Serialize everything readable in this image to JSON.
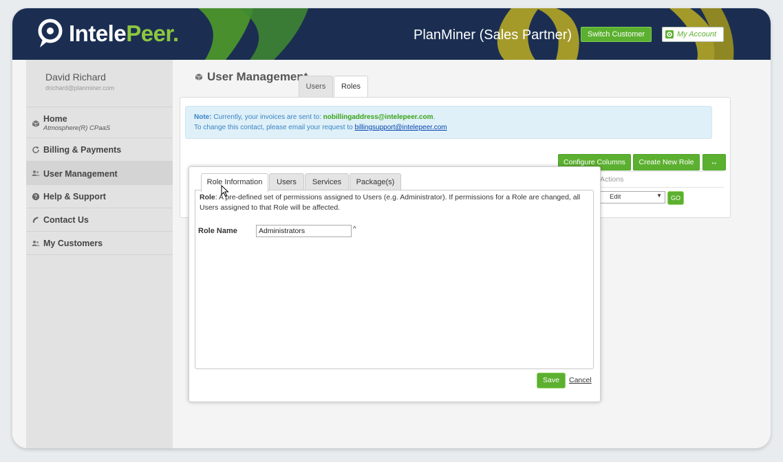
{
  "header": {
    "brand_part1": "Intele",
    "brand_part2": "Peer",
    "brand_mark": ".",
    "account_name": "PlanMiner (Sales Partner)",
    "switch_customer": "Switch Customer",
    "my_account": "My Account"
  },
  "user": {
    "name": "David Richard",
    "email": "drichard@planminer.com"
  },
  "sidebar": {
    "items": [
      {
        "label": "Home",
        "sub": "Atmosphere(R) CPaaS",
        "icon": "cube-icon"
      },
      {
        "label": "Billing & Payments",
        "icon": "refresh-icon"
      },
      {
        "label": "User Management",
        "icon": "users-icon"
      },
      {
        "label": "Help & Support",
        "icon": "help-circle-icon"
      },
      {
        "label": "Contact Us",
        "icon": "phone-icon"
      },
      {
        "label": "My Customers",
        "icon": "users-icon"
      }
    ]
  },
  "main": {
    "title": "User Management",
    "tabs": [
      "Users",
      "Roles"
    ],
    "note": {
      "label": "Note:",
      "line1_text": " Currently, your invoices are sent to: ",
      "line1_email": "nobillingaddress@intelepeer.com",
      "line1_end": ".",
      "line2_text": "To change this contact, please email your request to ",
      "line2_link": "billingsupport@intelepeer.com"
    },
    "buttons": {
      "configure_columns": "Configure Columns",
      "create_new_role": "Create New Role",
      "expand": "↔"
    },
    "table": {
      "actions_header": "Actions",
      "action_select_value": "Edit",
      "go": "GO"
    }
  },
  "modal": {
    "tabs": [
      "Role Information",
      "Users",
      "Services",
      "Package(s)"
    ],
    "role_desc_label": "Role",
    "role_desc_text": ": A pre-defined set of permissions assigned to Users (e.g. Administrator). If permissions for a Role are changed, all Users assigned to that Role will be affected.",
    "role_name_label": "Role Name",
    "role_name_value": "Administrators",
    "caret": "^",
    "save": "Save",
    "cancel": "Cancel"
  },
  "colors": {
    "header_bg": "#1b2e52",
    "accent_green": "#5cb030",
    "logo_green": "#8cc63f",
    "deco_olive": "#a39a2a"
  }
}
